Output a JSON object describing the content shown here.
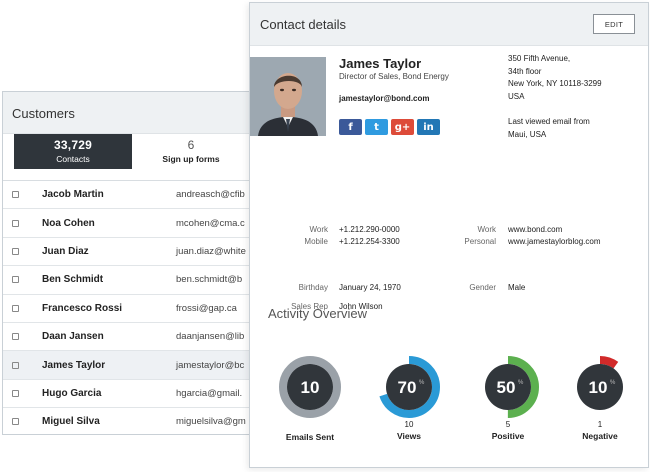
{
  "customers": {
    "title": "Customers",
    "stats": [
      {
        "value": "33,729",
        "label": "Contacts"
      },
      {
        "value": "6",
        "label": "Sign up forms"
      }
    ],
    "rows": [
      {
        "name": "Jacob Martin",
        "email": "andreasch@cfib"
      },
      {
        "name": "Noa Cohen",
        "email": "mcohen@cma.c"
      },
      {
        "name": "Juan Diaz",
        "email": "juan.diaz@white"
      },
      {
        "name": "Ben Schmidt",
        "email": "ben.schmidt@b"
      },
      {
        "name": "Francesco Rossi",
        "email": "frossi@gap.ca"
      },
      {
        "name": "Daan Jansen",
        "email": "daanjansen@lib"
      },
      {
        "name": "James Taylor",
        "email": "jamestaylor@bc"
      },
      {
        "name": "Hugo Garcia",
        "email": "hgarcia@gmail."
      },
      {
        "name": "Miguel Silva",
        "email": "miguelsilva@gm"
      }
    ],
    "selected_index": 6
  },
  "contact": {
    "title": "Contact details",
    "edit_label": "EDIT",
    "name": "James Taylor",
    "job": "Director of Sales, Bond Energy",
    "email": "jamestaylor@bond.com",
    "social": [
      {
        "icon": "facebook-icon",
        "glyph": "f"
      },
      {
        "icon": "twitter-icon",
        "glyph": "t"
      },
      {
        "icon": "google-plus-icon",
        "glyph": "g+"
      },
      {
        "icon": "linkedin-icon",
        "glyph": "in"
      }
    ],
    "address": [
      "350 Fifth Avenue,",
      "34th floor",
      "New York, NY 10118-3299",
      "USA"
    ],
    "last_viewed": [
      "Last viewed email from",
      "Maui, USA"
    ],
    "phone": {
      "work_label": "Work",
      "work_value": "+1.212.290-0000",
      "mobile_label": "Mobile",
      "mobile_value": "+1.212.254-3300"
    },
    "web": {
      "work_label": "Work",
      "work_value": "www.bond.com",
      "personal_label": "Personal",
      "personal_value": "www.jamestaylorblog.com"
    },
    "birthday_label": "Birthday",
    "birthday_value": "January 24, 1970",
    "gender_label": "Gender",
    "gender_value": "Male",
    "sales_rep_label": "Sales Rep",
    "sales_rep_value": "John Wilson"
  },
  "activity": {
    "title": "Activity Overview",
    "items": [
      {
        "center": "10",
        "count": "",
        "label": "Emails Sent",
        "fraction": 1.0,
        "color": "#9aa1a8",
        "pct": false
      },
      {
        "center": "70",
        "count": "10",
        "label": "Views",
        "fraction": 0.7,
        "color": "#2a9ad6",
        "pct": true
      },
      {
        "center": "50",
        "count": "5",
        "label": "Positive",
        "fraction": 0.5,
        "color": "#5cb04f",
        "pct": true
      },
      {
        "center": "10",
        "count": "1",
        "label": "Negative",
        "fraction": 0.1,
        "color": "#d12a2a",
        "pct": true
      }
    ]
  }
}
